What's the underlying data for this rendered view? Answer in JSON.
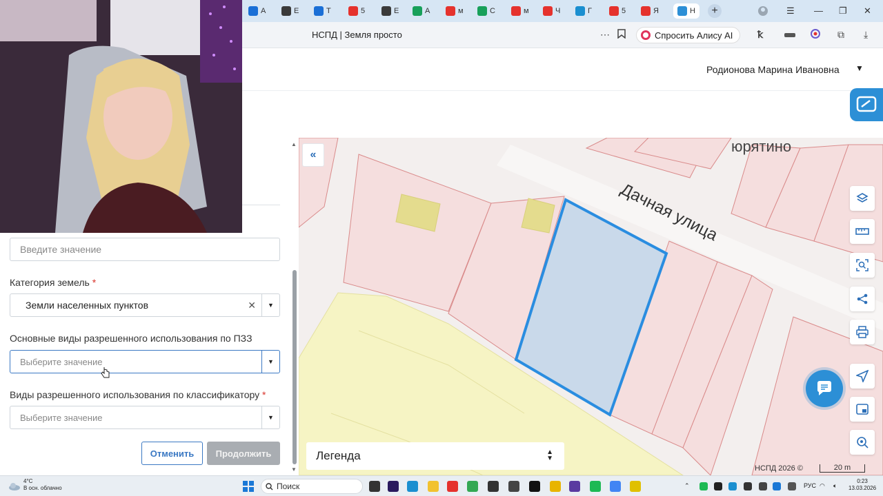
{
  "browser": {
    "tabs": [
      {
        "letter": "А",
        "color": "#1a6fd6"
      },
      {
        "letter": "Е",
        "color": "#3a3a3a"
      },
      {
        "letter": "Т",
        "color": "#1a6fd6"
      },
      {
        "letter": "5",
        "color": "#e5322d"
      },
      {
        "letter": "Е",
        "color": "#3a3a3a"
      },
      {
        "letter": "А",
        "color": "#18a05a"
      },
      {
        "letter": "м",
        "color": "#e5322d"
      },
      {
        "letter": "С",
        "color": "#18a05a"
      },
      {
        "letter": "м",
        "color": "#e5322d"
      },
      {
        "letter": "Ч",
        "color": "#e5322d"
      },
      {
        "letter": "Г",
        "color": "#1a8fd0"
      },
      {
        "letter": "5",
        "color": "#e5322d"
      },
      {
        "letter": "Я",
        "color": "#e5322d"
      },
      {
        "letter": "Н",
        "color": "#2c8fd6",
        "active": true
      }
    ],
    "page_title": "НСПД | Земля просто",
    "alice_button": "Спросить Алису AI"
  },
  "header": {
    "user_name": "Родионова Марина Ивановна"
  },
  "form": {
    "first_input_placeholder": "Введите значение",
    "land_category_label": "Категория земель",
    "land_category_value": "Земли населенных пунктов",
    "basic_use_label": "Основные виды разрешенного использования по ПЗЗ",
    "basic_use_placeholder": "Выберите значение",
    "classifier_use_label": "Виды разрешенного использования по классификатору",
    "classifier_use_placeholder": "Выберите значение",
    "required_mark": "*",
    "cancel_button": "Отменить",
    "continue_button": "Продолжить"
  },
  "map": {
    "street_label": "Дачная улица",
    "place_label": "юрятино",
    "legend_label": "Легенда",
    "copyright": "НСПД 2026 ©",
    "scale": "20 m",
    "colors": {
      "parcel_fill": "#f5dede",
      "parcel_stroke": "#d98a8a",
      "selected_fill": "#c9d9ea",
      "selected_stroke": "#2a8de0",
      "building_fill": "#e4dc8e",
      "zone_fill": "#f6f4c4"
    }
  },
  "taskbar": {
    "weather_temp": "4°C",
    "weather_desc": "В осн. облачно",
    "search_placeholder": "Поиск",
    "language": "РУС",
    "time": "0:23",
    "date": "13.03.2026"
  }
}
